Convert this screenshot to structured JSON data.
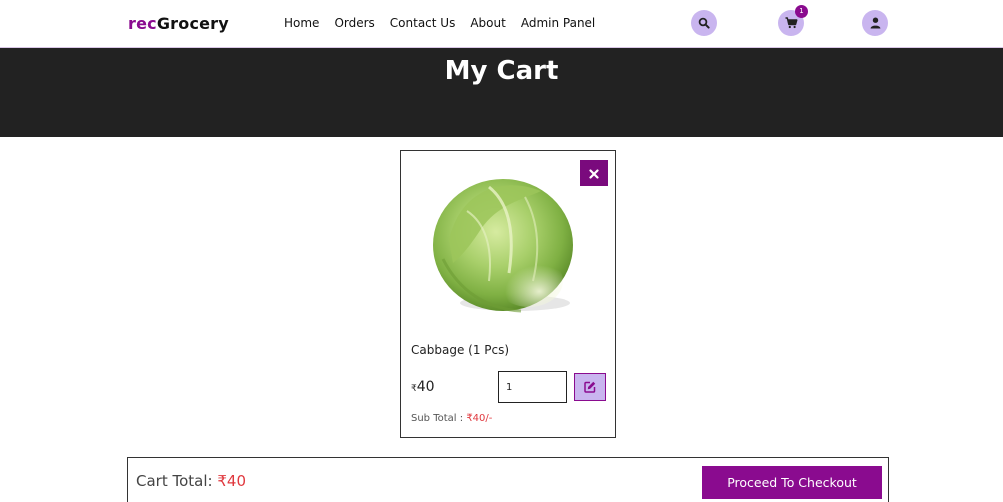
{
  "header": {
    "brand_prefix": "rec",
    "brand_suffix": "Grocery",
    "nav": [
      "Home",
      "Orders",
      "Contact Us",
      "About",
      "Admin Panel"
    ],
    "cart_count": "1",
    "icons": [
      "search-icon",
      "shopping-cart-icon",
      "user-icon"
    ]
  },
  "banner": {
    "title": "My Cart"
  },
  "cart_item": {
    "name": "Cabbage (1 Pcs)",
    "currency": "₹",
    "price": "40",
    "quantity": "1",
    "subtotal_label": "Sub Total :",
    "subtotal_value": "₹40/-",
    "image": "cabbage"
  },
  "cart_total": {
    "label": "Cart Total:",
    "value": "₹40",
    "checkout_label": "Proceed To Checkout"
  },
  "colors": {
    "brand": "#8a0b8f",
    "accent_light": "#c9b5ef",
    "banner_bg": "#222222",
    "price_red": "#e0383e"
  }
}
